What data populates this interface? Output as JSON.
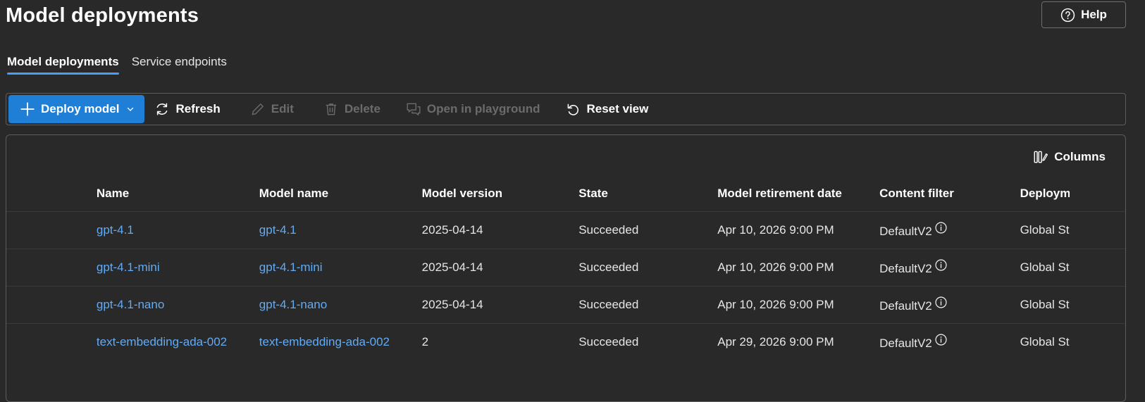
{
  "page": {
    "title": "Model deployments"
  },
  "help": {
    "label": "Help",
    "icon": "question-circle-icon"
  },
  "tabs": [
    {
      "label": "Model deployments",
      "active": true
    },
    {
      "label": "Service endpoints",
      "active": false
    }
  ],
  "toolbar": {
    "deploy_label": "Deploy model",
    "refresh_label": "Refresh",
    "edit_label": "Edit",
    "delete_label": "Delete",
    "playground_label": "Open in playground",
    "reset_label": "Reset view"
  },
  "grid": {
    "columns_label": "Columns",
    "headers": [
      "Name",
      "Model name",
      "Model version",
      "State",
      "Model retirement date",
      "Content filter",
      "Deploym"
    ],
    "rows": [
      {
        "name": "gpt-4.1",
        "model_name": "gpt-4.1",
        "version": "2025-04-14",
        "state": "Succeeded",
        "retirement": "Apr 10, 2026 9:00 PM",
        "filter": "DefaultV2",
        "deployment": "Global St"
      },
      {
        "name": "gpt-4.1-mini",
        "model_name": "gpt-4.1-mini",
        "version": "2025-04-14",
        "state": "Succeeded",
        "retirement": "Apr 10, 2026 9:00 PM",
        "filter": "DefaultV2",
        "deployment": "Global St"
      },
      {
        "name": "gpt-4.1-nano",
        "model_name": "gpt-4.1-nano",
        "version": "2025-04-14",
        "state": "Succeeded",
        "retirement": "Apr 10, 2026 9:00 PM",
        "filter": "DefaultV2",
        "deployment": "Global St"
      },
      {
        "name": "text-embedding-ada-002",
        "model_name": "text-embedding-ada-002",
        "version": "2",
        "state": "Succeeded",
        "retirement": "Apr 29, 2026 9:00 PM",
        "filter": "DefaultV2",
        "deployment": "Global St"
      }
    ]
  },
  "colors": {
    "background": "#292929",
    "accent": "#1f7fd6",
    "link": "#62abf5",
    "tab_indicator": "#479ef5",
    "disabled": "#6b6b6b"
  }
}
